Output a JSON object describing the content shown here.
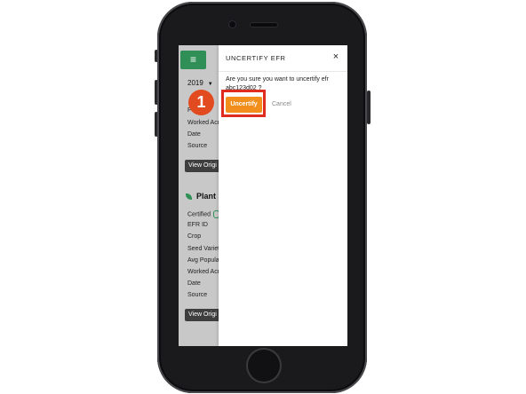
{
  "sidebar": {
    "year_selected": "2019",
    "section1_rows": [
      "F",
      "Worked Acr",
      "Date",
      "Source"
    ],
    "view_button": "View Origi",
    "plant_title": "Plant",
    "section2_rows": [
      "Certified",
      "EFR ID",
      "Crop",
      "Seed Variet",
      "Avg Popula",
      "Worked Acr",
      "Date",
      "Source"
    ]
  },
  "modal": {
    "title": "UNCERTIFY EFR",
    "close_symbol": "×",
    "message": "Are you sure you want to uncertify efr abc123d02 ?",
    "confirm_label": "Uncertify",
    "cancel_label": "Cancel"
  },
  "annotation": {
    "step_number": "1",
    "marker_color": "#e24a1f",
    "highlight_color": "#e02b1f"
  },
  "colors": {
    "brand_green": "#2f8f57",
    "confirm_orange": "#f28f1c"
  },
  "icons": {
    "menu": "hamburger-icon",
    "plant": "leaf-icon",
    "close": "close-icon"
  }
}
